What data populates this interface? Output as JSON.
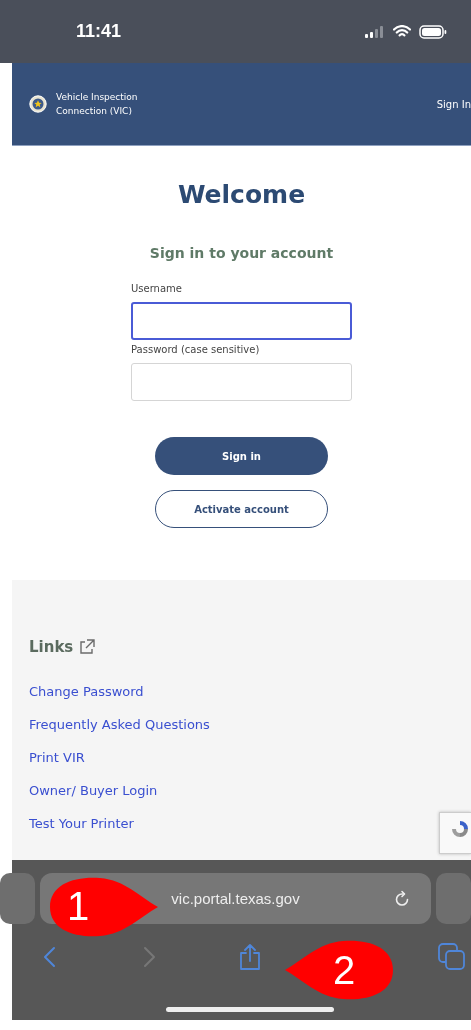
{
  "status_bar": {
    "time": "11:41"
  },
  "header": {
    "site_name": "Vehicle Inspection Connection (VIC)",
    "sign_in_link": "Sign In"
  },
  "login": {
    "title": "Welcome",
    "subtitle": "Sign in to your account",
    "fields": [
      {
        "label": "Username",
        "focused": true
      },
      {
        "label": "Password (case sensitive)",
        "focused": false
      }
    ],
    "buttons": [
      {
        "label": "Sign in",
        "kind": "primary"
      },
      {
        "label": "Activate account",
        "kind": "outline"
      }
    ]
  },
  "links": {
    "heading": "Links",
    "items": [
      "Change Password",
      "Frequently Asked Questions",
      "Print VIR",
      "Owner/ Buyer Login",
      "Test Your Printer"
    ]
  },
  "browser": {
    "url": "vic.portal.texas.gov",
    "back_enabled": true,
    "forward_enabled": false
  },
  "annotations": [
    {
      "label": "1",
      "kind": "right"
    },
    {
      "label": "2",
      "kind": "left"
    }
  ]
}
